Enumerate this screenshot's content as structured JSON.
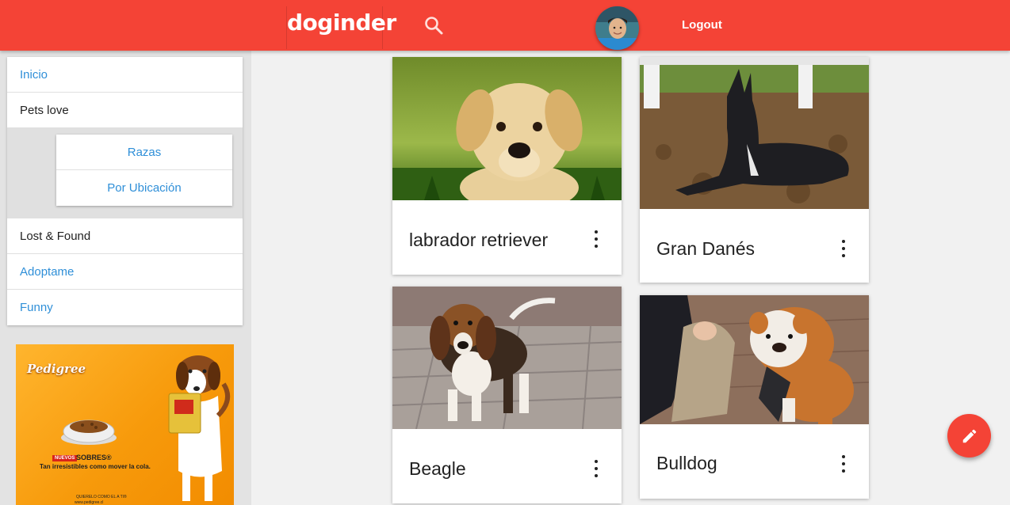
{
  "header": {
    "brand": "doginder",
    "logout_label": "Logout",
    "color": "#f44336"
  },
  "sidebar": {
    "items": [
      {
        "label": "Inicio"
      },
      {
        "label": "Pets love"
      },
      {
        "label": "Lost & Found"
      },
      {
        "label": "Adoptame"
      },
      {
        "label": "Funny"
      }
    ],
    "submenu": [
      {
        "label": "Razas"
      },
      {
        "label": "Por Ubicación"
      }
    ],
    "link_color": "#2f8fd8"
  },
  "ad": {
    "brand": "Pedigree",
    "badge": "NUEVOS",
    "title": "SOBRES®",
    "subtitle": "Tan irresistibles como mover la cola.",
    "foot1": "QUIERELO COMO EL A TI®",
    "foot2": "www.pedigree.cl"
  },
  "cards": [
    {
      "title": "labrador retriever",
      "icon": "more-vert-icon"
    },
    {
      "title": "Gran Danés",
      "icon": "more-vert-icon"
    },
    {
      "title": "Beagle",
      "icon": "more-vert-icon"
    },
    {
      "title": "Bulldog",
      "icon": "more-vert-icon"
    }
  ],
  "fab": {
    "icon": "edit-icon"
  }
}
